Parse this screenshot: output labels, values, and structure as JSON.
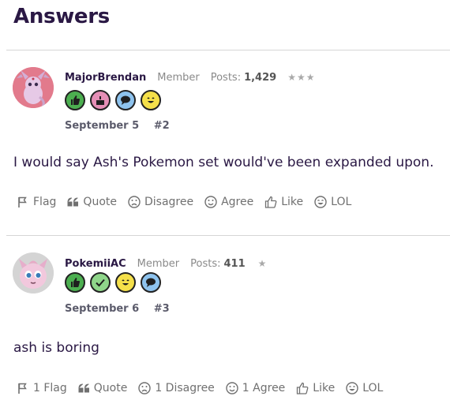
{
  "section_title": "Answers",
  "posts": [
    {
      "username": "MajorBrendan",
      "role": "Member",
      "posts_label": "Posts:",
      "posts_count": "1,429",
      "stars": "★★★",
      "badges": [
        "thumbs-up",
        "cake",
        "speech-bubble",
        "smiley"
      ],
      "date": "September 5",
      "number": "#2",
      "body": "I would say Ash's Pokemon set would've been expanded upon.",
      "actions": {
        "flag": "Flag",
        "quote": "Quote",
        "disagree": "Disagree",
        "agree": "Agree",
        "like": "Like",
        "lol": "LOL"
      }
    },
    {
      "username": "PokemiiAC",
      "role": "Member",
      "posts_label": "Posts:",
      "posts_count": "411",
      "stars": "★",
      "badges": [
        "thumbs-up",
        "checkmark",
        "smiley",
        "speech-bubble"
      ],
      "date": "September 6",
      "number": "#3",
      "body": "ash is boring",
      "actions": {
        "flag": "1 Flag",
        "quote": "Quote",
        "disagree": "1 Disagree",
        "agree": "1 Agree",
        "like": "Like",
        "lol": "LOL"
      }
    }
  ]
}
